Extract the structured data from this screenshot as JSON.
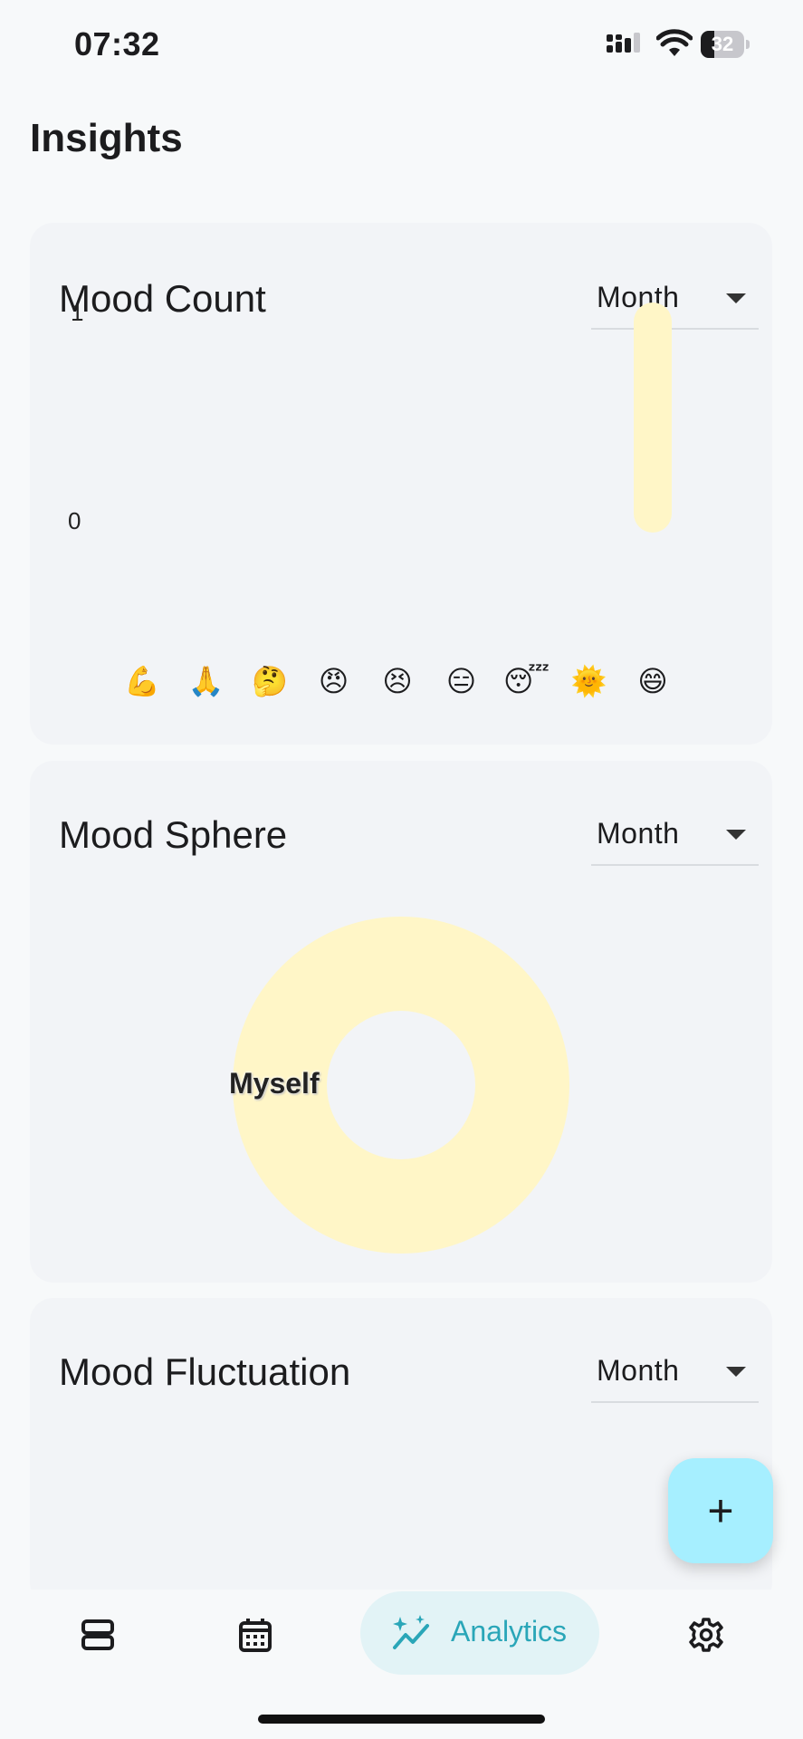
{
  "status_bar": {
    "time": "07:32",
    "battery": "32",
    "battery_percent": 32
  },
  "page": {
    "title": "Insights"
  },
  "cards": {
    "mood_count": {
      "title": "Mood Count",
      "period": "Month",
      "chart_data": {
        "type": "bar",
        "categories": [
          "💪",
          "🙏",
          "🤔",
          "😠",
          "😣",
          "😑",
          "😴",
          "🌞",
          "😄"
        ],
        "values": [
          0,
          0,
          0,
          0,
          0,
          0,
          0,
          0,
          1
        ],
        "ylim": [
          0,
          1
        ],
        "yticks": [
          "0",
          "1"
        ],
        "bar_color": "#fff6c7",
        "grid": false,
        "legend": "none"
      }
    },
    "mood_sphere": {
      "title": "Mood Sphere",
      "period": "Month",
      "chart_data": {
        "type": "pie",
        "donut": true,
        "slices": [
          {
            "label": "Myself",
            "value": 1,
            "color": "#fff6c7"
          }
        ]
      }
    },
    "mood_fluctuation": {
      "title": "Mood Fluctuation",
      "period": "Month"
    }
  },
  "fab": {
    "label": "+"
  },
  "bottom_nav": {
    "items": [
      {
        "icon": "list-icon"
      },
      {
        "icon": "calendar-icon"
      },
      {
        "icon": "sparkle-chart-icon",
        "label": "Analytics",
        "active": true
      },
      {
        "icon": "gear-icon"
      }
    ]
  },
  "colors": {
    "accent": "#2aa6b8",
    "fab": "#a6efff",
    "mood_yellow": "#fff6c7"
  }
}
